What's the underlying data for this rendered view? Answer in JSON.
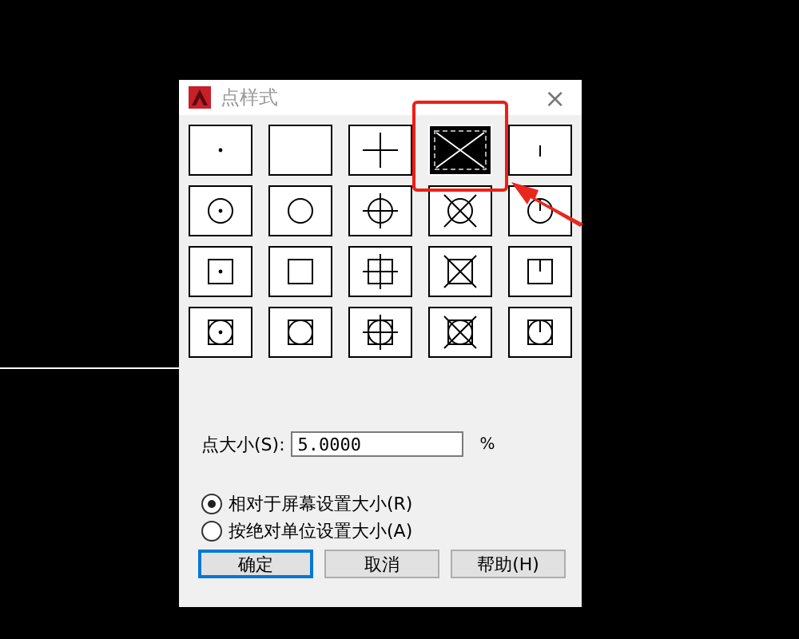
{
  "window": {
    "title": "点样式",
    "close": "×"
  },
  "styles": [
    {
      "kind": "dot",
      "circle": false,
      "square": false,
      "selected": false
    },
    {
      "kind": "none",
      "circle": false,
      "square": false,
      "selected": false
    },
    {
      "kind": "plus",
      "circle": false,
      "square": false,
      "selected": false
    },
    {
      "kind": "cross",
      "circle": false,
      "square": false,
      "selected": true
    },
    {
      "kind": "tick",
      "circle": false,
      "square": false,
      "selected": false
    },
    {
      "kind": "dot",
      "circle": true,
      "square": false,
      "selected": false
    },
    {
      "kind": "none",
      "circle": true,
      "square": false,
      "selected": false
    },
    {
      "kind": "plus",
      "circle": true,
      "square": false,
      "selected": false
    },
    {
      "kind": "cross",
      "circle": true,
      "square": false,
      "selected": false
    },
    {
      "kind": "tick",
      "circle": true,
      "square": false,
      "selected": false
    },
    {
      "kind": "dot",
      "circle": false,
      "square": true,
      "selected": false
    },
    {
      "kind": "none",
      "circle": false,
      "square": true,
      "selected": false
    },
    {
      "kind": "plus",
      "circle": false,
      "square": true,
      "selected": false
    },
    {
      "kind": "cross",
      "circle": false,
      "square": true,
      "selected": false
    },
    {
      "kind": "tick",
      "circle": false,
      "square": true,
      "selected": false
    },
    {
      "kind": "dot",
      "circle": true,
      "square": true,
      "selected": false
    },
    {
      "kind": "none",
      "circle": true,
      "square": true,
      "selected": false
    },
    {
      "kind": "plus",
      "circle": true,
      "square": true,
      "selected": false
    },
    {
      "kind": "cross",
      "circle": true,
      "square": true,
      "selected": false
    },
    {
      "kind": "tick",
      "circle": true,
      "square": true,
      "selected": false
    }
  ],
  "point_size": {
    "label": "点大小(S):",
    "value": "5.0000",
    "unit": "%"
  },
  "size_modes": [
    {
      "label": "相对于屏幕设置大小(R)",
      "selected": true
    },
    {
      "label": "按绝对单位设置大小(A)",
      "selected": false
    }
  ],
  "buttons": [
    {
      "label": "确定",
      "default": true
    },
    {
      "label": "取消",
      "default": false
    },
    {
      "label": "帮助(H)",
      "default": false
    }
  ]
}
